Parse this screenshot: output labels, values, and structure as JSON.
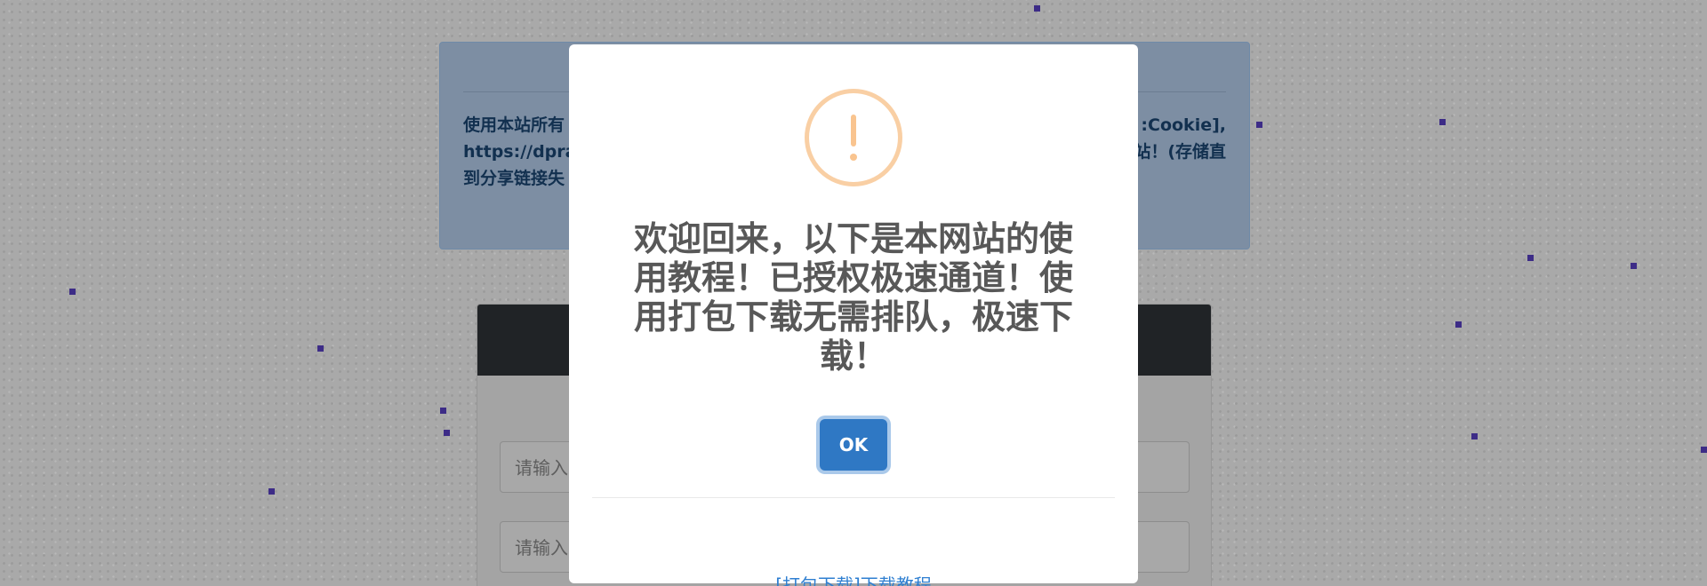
{
  "background_page": {
    "notice": {
      "left_text": "使用本站所有\nhttps://dpran\n到分享链接失",
      "right_text": ":Cookie],\n站！(存储直\n"
    },
    "inputs": [
      {
        "placeholder": "请输入"
      },
      {
        "placeholder": "请输入"
      }
    ]
  },
  "modal": {
    "icon": "warning-exclamation-icon",
    "title": "欢迎回来，以下是本网站的使用教程！已授权极速通道！使用打包下载无需排队，极速下载！",
    "ok_label": "OK",
    "footer_link": "[打包下载]下载教程"
  },
  "colors": {
    "overlay_bg": "#a9a9a9",
    "notice_bg": "#7d8ea3",
    "notice_text": "#12304f",
    "warning_icon": "#f9c48f",
    "ok_button": "#2f78c4",
    "link": "#2f7fd1",
    "particles": "#3d2c87"
  }
}
